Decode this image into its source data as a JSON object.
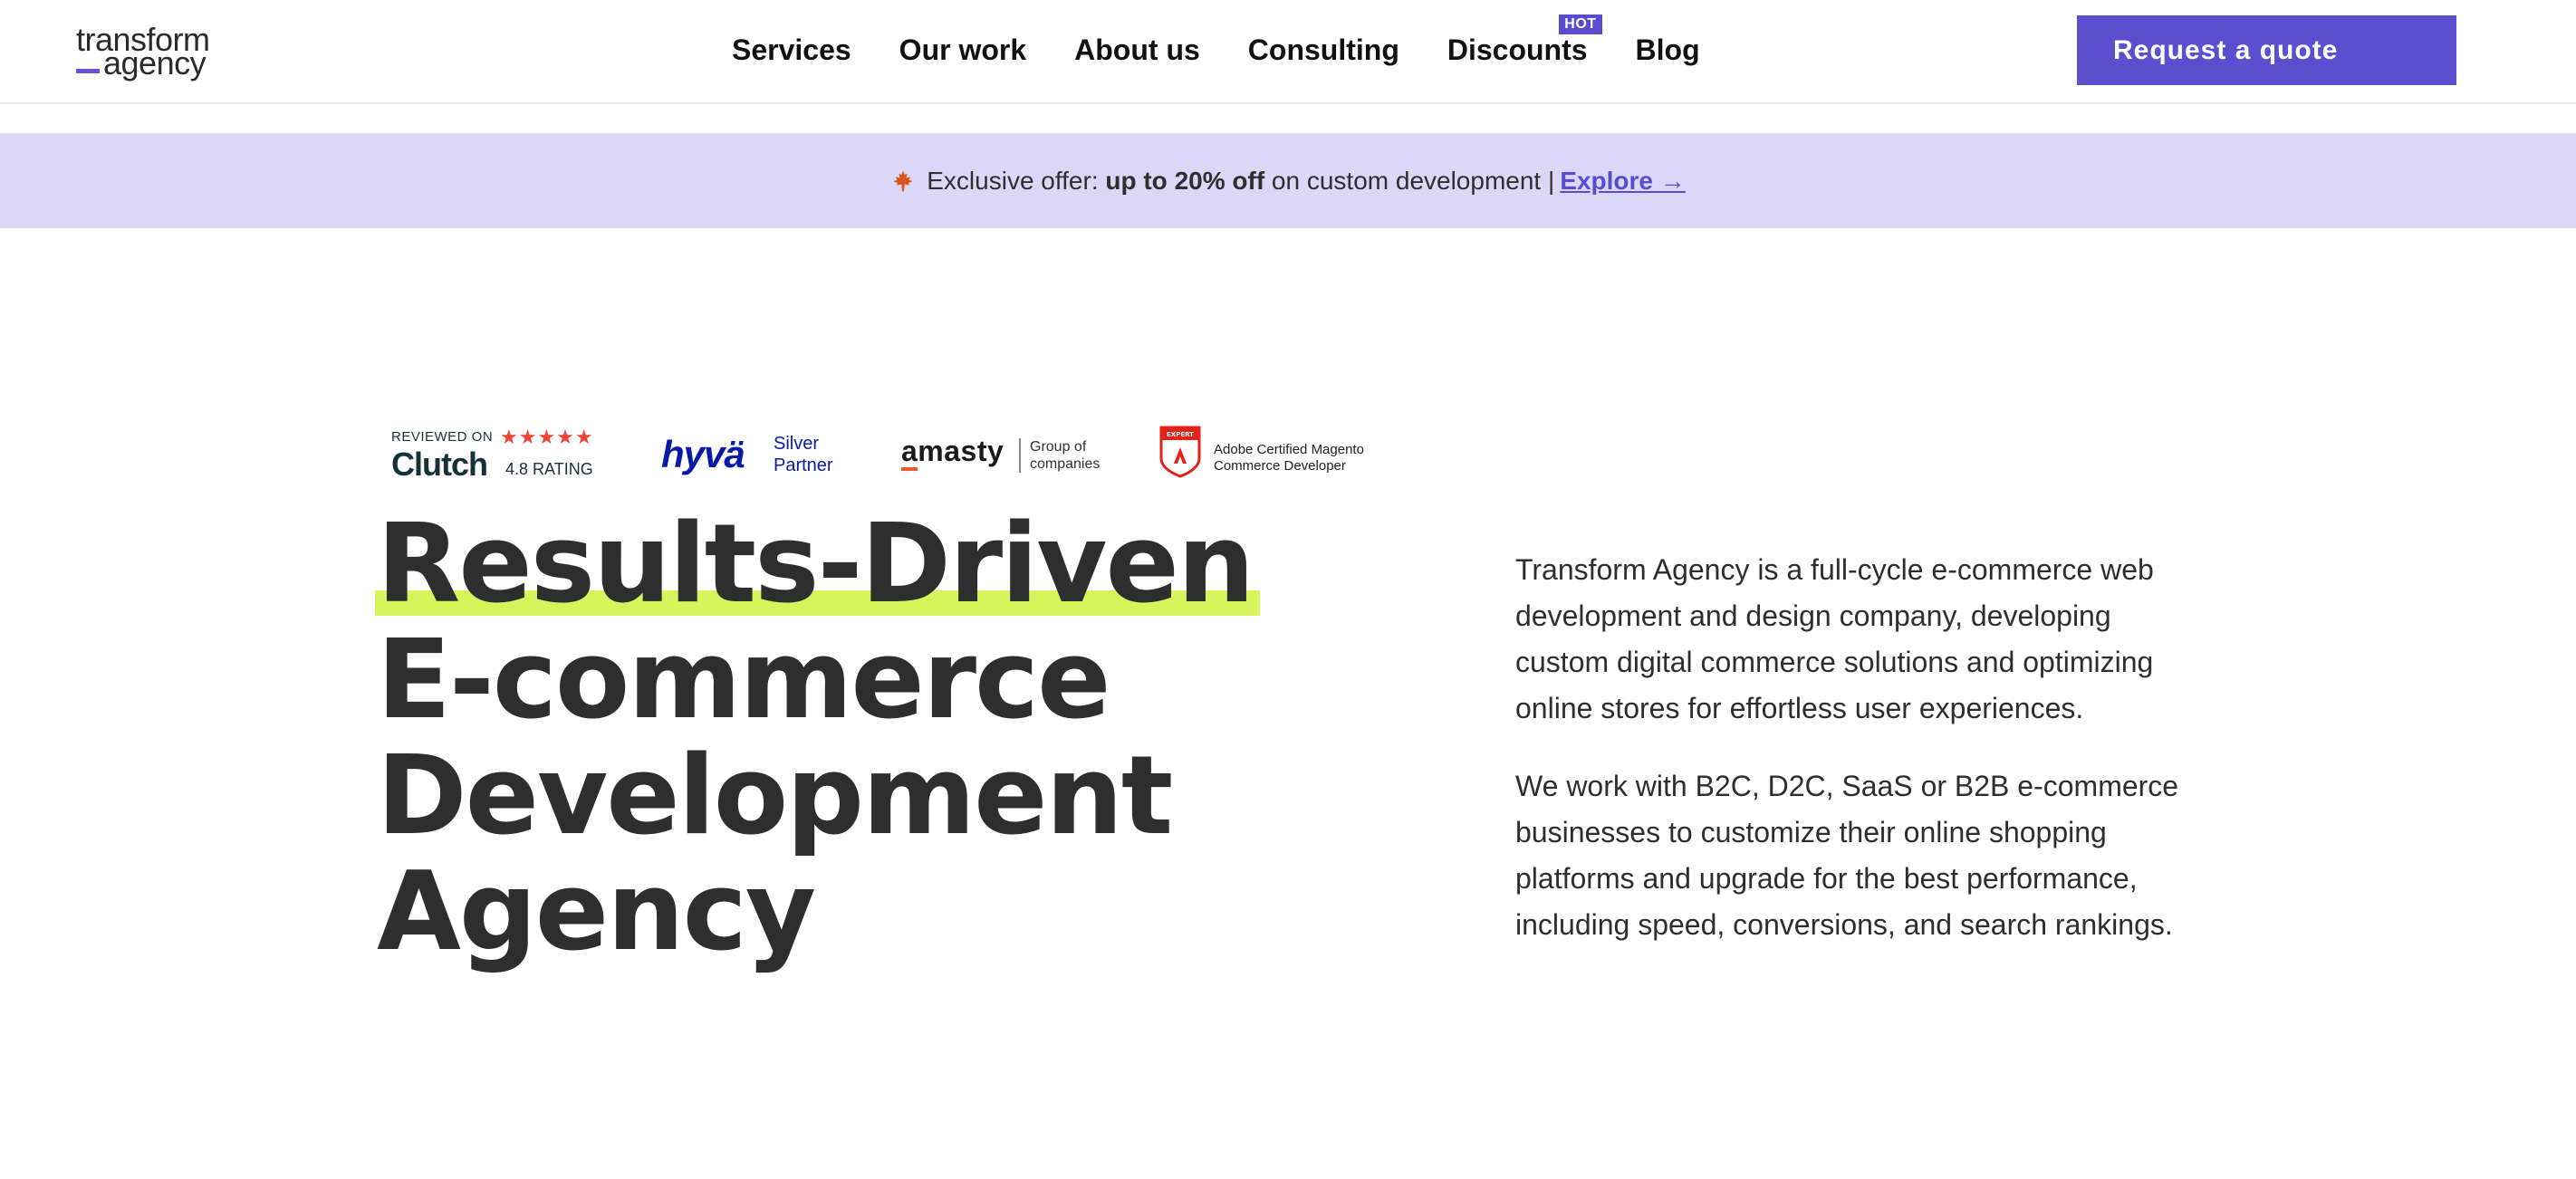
{
  "header": {
    "logo": {
      "line1": "transform",
      "line2": "agency"
    },
    "nav": [
      {
        "label": "Services"
      },
      {
        "label": "Our work"
      },
      {
        "label": "About us"
      },
      {
        "label": "Consulting"
      },
      {
        "label": "Discounts",
        "badge": "HOT"
      },
      {
        "label": "Blog"
      }
    ],
    "cta_label": "Request a quote"
  },
  "banner": {
    "icon": "maple-leaf-icon",
    "prefix": "Exclusive offer:",
    "highlight": "up to 20% off",
    "suffix": "on custom development |",
    "link": "Explore →"
  },
  "badges": {
    "clutch": {
      "reviewed": "REVIEWED ON",
      "name": "Clutch",
      "stars": "★★★★★",
      "rating": "4.8 RATING"
    },
    "hyva": {
      "name": "hyvä",
      "line1": "Silver",
      "line2": "Partner"
    },
    "amasty": {
      "name": "amasty",
      "line1": "Group of",
      "line2": "companies"
    },
    "adobe": {
      "badge": "EXPERT",
      "line1": "Adobe Certified Magento",
      "line2": "Commerce Developer"
    }
  },
  "hero": {
    "headline": [
      "Results-Driven",
      "E-commerce",
      "Development",
      "Agency"
    ],
    "paragraphs": [
      "Transform Agency is a full-cycle e-commerce web development and design company, developing custom digital commerce solutions and optimizing online stores for effortless user experiences.",
      "We work with B2C, D2C, SaaS or B2B e-commerce businesses to customize their online shopping platforms and upgrade for the best performance, including speed, conversions, and search rankings."
    ]
  },
  "colors": {
    "brand": "#5b4fd0",
    "banner_bg": "#dcd6f7",
    "highlight": "#d8f45c",
    "text": "#2e2e2e"
  }
}
